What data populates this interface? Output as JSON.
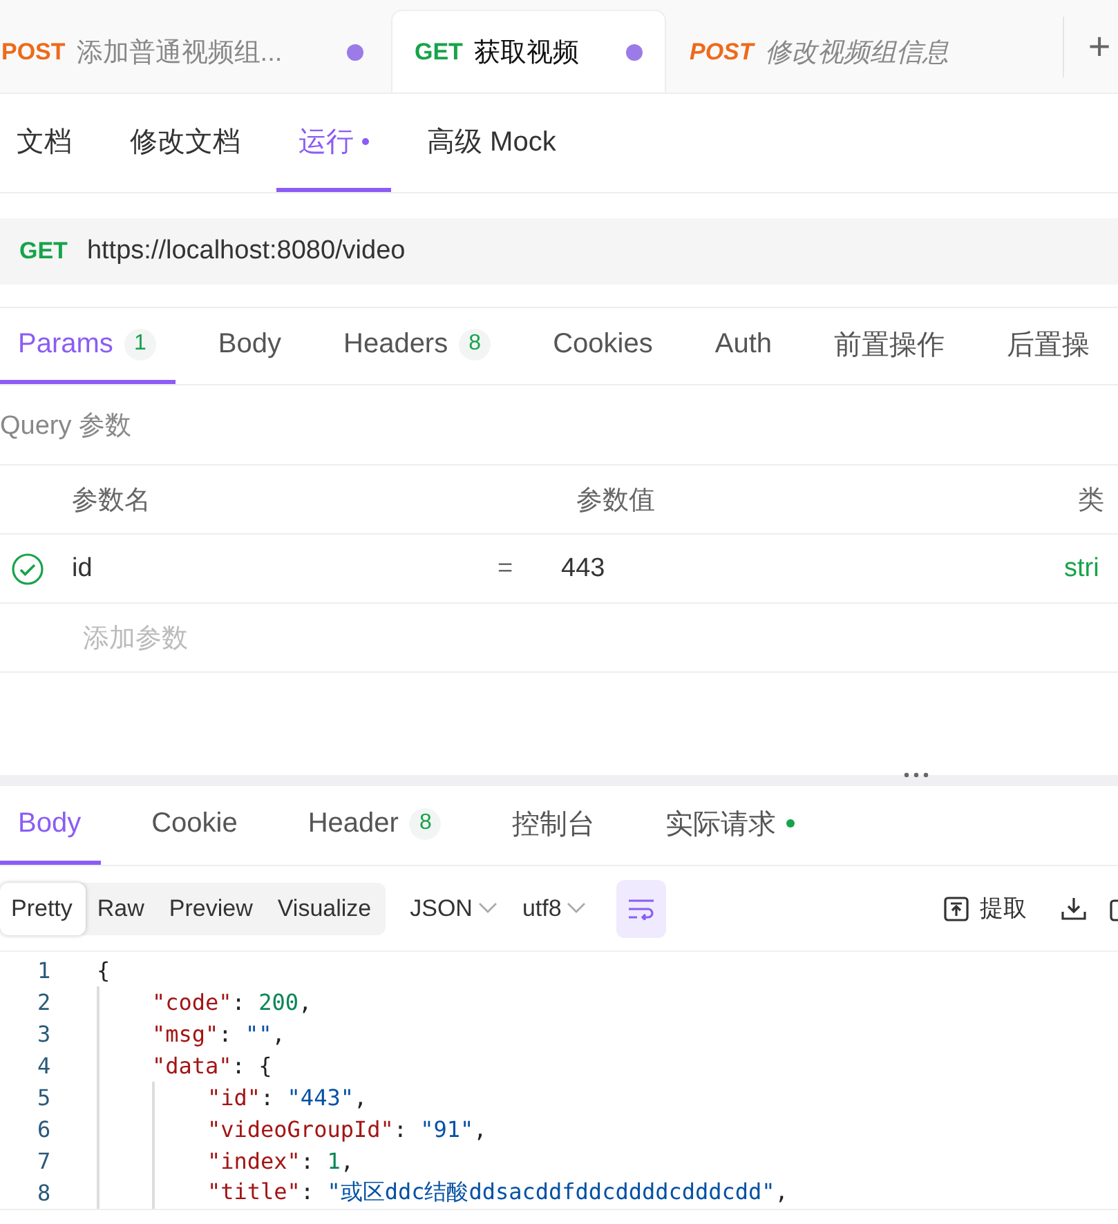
{
  "request_tabs": [
    {
      "method": "POST",
      "name": "添加普通视频组...",
      "selected": false,
      "preview": false,
      "unsaved": true
    },
    {
      "method": "GET",
      "name": "获取视频",
      "selected": true,
      "preview": false,
      "unsaved": true
    },
    {
      "method": "POST",
      "name": "修改视频组信息",
      "selected": false,
      "preview": true,
      "unsaved": false
    }
  ],
  "new_tab": "+",
  "mode_tabs": [
    {
      "label": "文档",
      "selected": false,
      "dot": false
    },
    {
      "label": "修改文档",
      "selected": false,
      "dot": false
    },
    {
      "label": "运行",
      "selected": true,
      "dot": true
    },
    {
      "label": "高级 Mock",
      "selected": false,
      "dot": false
    }
  ],
  "url_bar": {
    "method": "GET",
    "url": "https://localhost:8080/video"
  },
  "request_tabs_params": [
    {
      "label": "Params",
      "count": "1",
      "selected": true
    },
    {
      "label": "Body",
      "selected": false
    },
    {
      "label": "Headers",
      "count": "8",
      "selected": false
    },
    {
      "label": "Cookies",
      "selected": false
    },
    {
      "label": "Auth",
      "selected": false
    },
    {
      "label": "前置操作",
      "selected": false
    },
    {
      "label": "后置操",
      "selected": false
    }
  ],
  "query_section": "Query 参数",
  "params_table": {
    "columns": [
      "参数名",
      "参数值",
      "类"
    ],
    "rows": [
      {
        "checked": true,
        "name": "id",
        "operator": "=",
        "value": "443",
        "type": "stri"
      }
    ],
    "add_placeholder": "添加参数"
  },
  "response_tabs": [
    {
      "label": "Body",
      "selected": true,
      "dot": false
    },
    {
      "label": "Cookie",
      "selected": false,
      "dot": false
    },
    {
      "label": "Header",
      "count": "8",
      "selected": false,
      "dot": false
    },
    {
      "label": "控制台",
      "selected": false,
      "dot": false
    },
    {
      "label": "实际请求",
      "selected": false,
      "dot": true
    }
  ],
  "view_modes": [
    {
      "label": "Pretty",
      "selected": true
    },
    {
      "label": "Raw",
      "selected": false
    },
    {
      "label": "Preview",
      "selected": false
    },
    {
      "label": "Visualize",
      "selected": false
    }
  ],
  "format_select": "JSON",
  "encoding_select": "utf8",
  "wrap_on": true,
  "extract_button": "提取",
  "code_lines": [
    {
      "number": "1",
      "tokens": [
        {
          "kind": "punct",
          "text": "{"
        }
      ]
    },
    {
      "number": "2",
      "tokens": [
        {
          "kind": "key",
          "text": "\"code\""
        },
        {
          "kind": "punct",
          "text": ": "
        },
        {
          "kind": "number",
          "text": "200"
        },
        {
          "kind": "punct",
          "text": ","
        }
      ]
    },
    {
      "number": "3",
      "tokens": [
        {
          "kind": "key",
          "text": "\"msg\""
        },
        {
          "kind": "punct",
          "text": ": "
        },
        {
          "kind": "string",
          "text": "\"\""
        },
        {
          "kind": "punct",
          "text": ","
        }
      ]
    },
    {
      "number": "4",
      "tokens": [
        {
          "kind": "key",
          "text": "\"data\""
        },
        {
          "kind": "punct",
          "text": ": {"
        }
      ]
    },
    {
      "number": "5",
      "tokens": [
        {
          "kind": "key",
          "text": "\"id\""
        },
        {
          "kind": "punct",
          "text": ": "
        },
        {
          "kind": "string",
          "text": "\"443\""
        },
        {
          "kind": "punct",
          "text": ","
        }
      ]
    },
    {
      "number": "6",
      "tokens": [
        {
          "kind": "key",
          "text": "\"videoGroupId\""
        },
        {
          "kind": "punct",
          "text": ": "
        },
        {
          "kind": "string",
          "text": "\"91\""
        },
        {
          "kind": "punct",
          "text": ","
        }
      ]
    },
    {
      "number": "7",
      "tokens": [
        {
          "kind": "key",
          "text": "\"index\""
        },
        {
          "kind": "punct",
          "text": ": "
        },
        {
          "kind": "number",
          "text": "1"
        },
        {
          "kind": "punct",
          "text": ","
        }
      ]
    },
    {
      "number": "8",
      "tokens": [
        {
          "kind": "key",
          "text": "\"title\""
        },
        {
          "kind": "punct",
          "text": ": "
        },
        {
          "kind": "string",
          "text": "\"或区ddc结酸ddsacddfddcddddcdddcdd\""
        },
        {
          "kind": "punct",
          "text": ","
        }
      ]
    }
  ]
}
